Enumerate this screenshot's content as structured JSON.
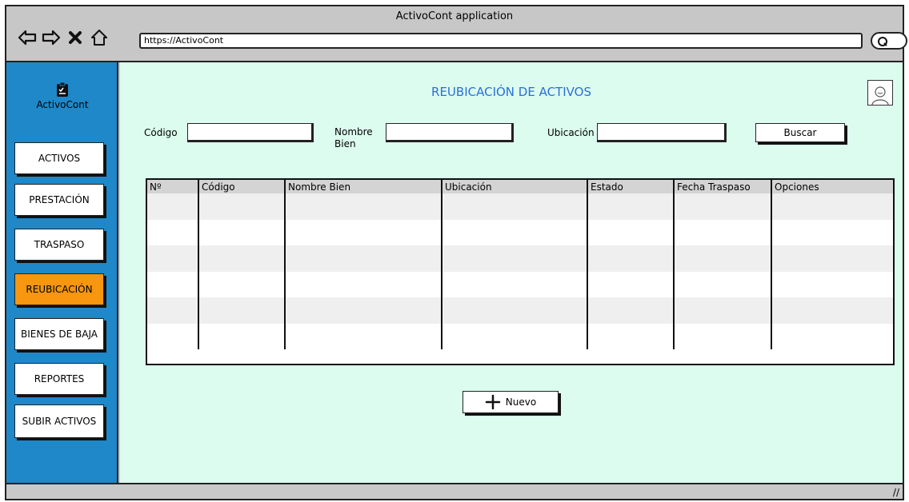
{
  "window": {
    "title": "ActivoCont application",
    "url": "https://ActivoCont"
  },
  "nav": {
    "back_icon": "back-arrow-icon",
    "forward_icon": "forward-arrow-icon",
    "stop_icon": "close-x-icon",
    "home_icon": "home-icon",
    "search_icon": "search-icon"
  },
  "sidebar": {
    "logo_label": "ActivoCont",
    "logo_icon": "clipboard-icon",
    "items": [
      {
        "label": "ACTIVOS"
      },
      {
        "label": "PRESTACIÓN"
      },
      {
        "label": "TRASPASO"
      },
      {
        "label": "REUBICACIÓN"
      },
      {
        "label": "BIENES DE BAJA"
      },
      {
        "label": "REPORTES"
      },
      {
        "label": "SUBIR ACTIVOS"
      }
    ],
    "active_item": "REUBICACIÓN"
  },
  "main": {
    "title": "REUBICACIÓN DE ACTIVOS",
    "avatar_icon": "user-avatar-icon",
    "filters": {
      "codigo_label": "Código",
      "codigo_value": "",
      "nombre_label_line1": "Nombre",
      "nombre_label_line2": "Bien",
      "nombre_value": "",
      "ubicacion_label": "Ubicación",
      "ubicacion_value": "",
      "search_button": "Buscar"
    },
    "table": {
      "columns": [
        "Nº",
        "Código",
        "Nombre Bien",
        "Ubicación",
        "Estado",
        "Fecha Traspaso",
        "Opciones"
      ],
      "rows": [
        [
          "",
          "",
          "",
          "",
          "",
          "",
          ""
        ],
        [
          "",
          "",
          "",
          "",
          "",
          "",
          ""
        ],
        [
          "",
          "",
          "",
          "",
          "",
          "",
          ""
        ],
        [
          "",
          "",
          "",
          "",
          "",
          "",
          ""
        ],
        [
          "",
          "",
          "",
          "",
          "",
          "",
          ""
        ],
        [
          "",
          "",
          "",
          "",
          "",
          "",
          ""
        ]
      ]
    },
    "new_button": "Nuevo",
    "new_button_icon": "plus-icon"
  },
  "colors": {
    "sidebar_bg": "#1e88c9",
    "active_item_bg": "#f7960f",
    "content_bg": "#dcfcef",
    "title_color": "#2a6fd8"
  }
}
